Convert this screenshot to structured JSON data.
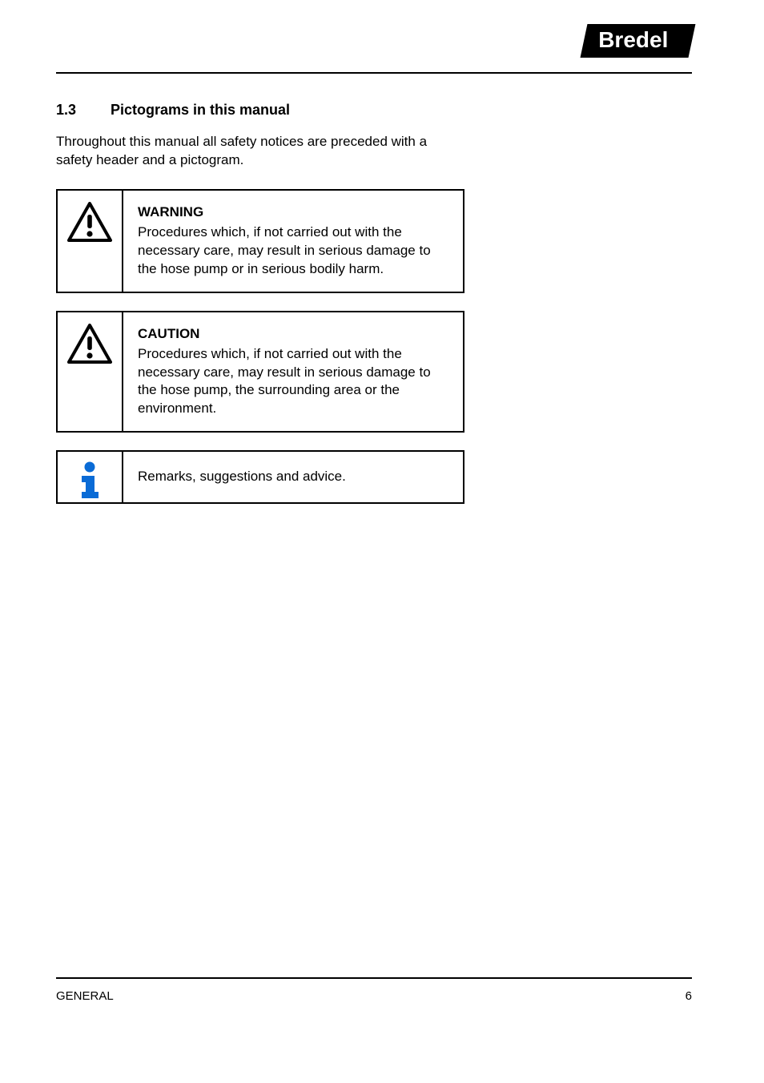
{
  "brand": "Bredel",
  "section": {
    "number": "1.3",
    "title": "Pictograms in this manual"
  },
  "intro": "Throughout this manual all safety notices are preceded with a safety header and a pictogram.",
  "callouts": [
    {
      "icon": "warning-icon",
      "heading": "WARNING",
      "body": "Procedures which, if not carried out with the necessary care, may result in serious damage to the hose pump or in serious bodily harm."
    },
    {
      "icon": "warning-icon",
      "heading": "CAUTION",
      "body": "Procedures which, if not carried out with the necessary care, may result in serious damage to the hose pump, the surrounding area or the environment."
    },
    {
      "icon": "info-icon",
      "heading": "",
      "body": "Remarks, suggestions and advice."
    }
  ],
  "footer": {
    "left": "GENERAL",
    "right": "6"
  }
}
